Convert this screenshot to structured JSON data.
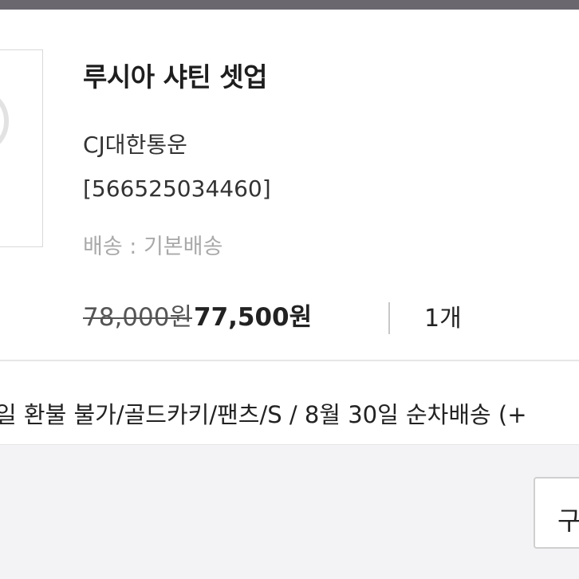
{
  "order": {
    "product_name": "루시아 샤틴 셋업",
    "carrier": "CJ대한통운",
    "tracking_number": "[566525034460]",
    "shipping_label": "배송 : 기본배송",
    "original_price": "78,000원",
    "sale_price": "77,500원",
    "quantity": "1개",
    "option_text": "일 환불 불가/골드카키/팬츠/S / 8월 30일 순차배송 (+"
  },
  "footer": {
    "button_label": "구"
  }
}
